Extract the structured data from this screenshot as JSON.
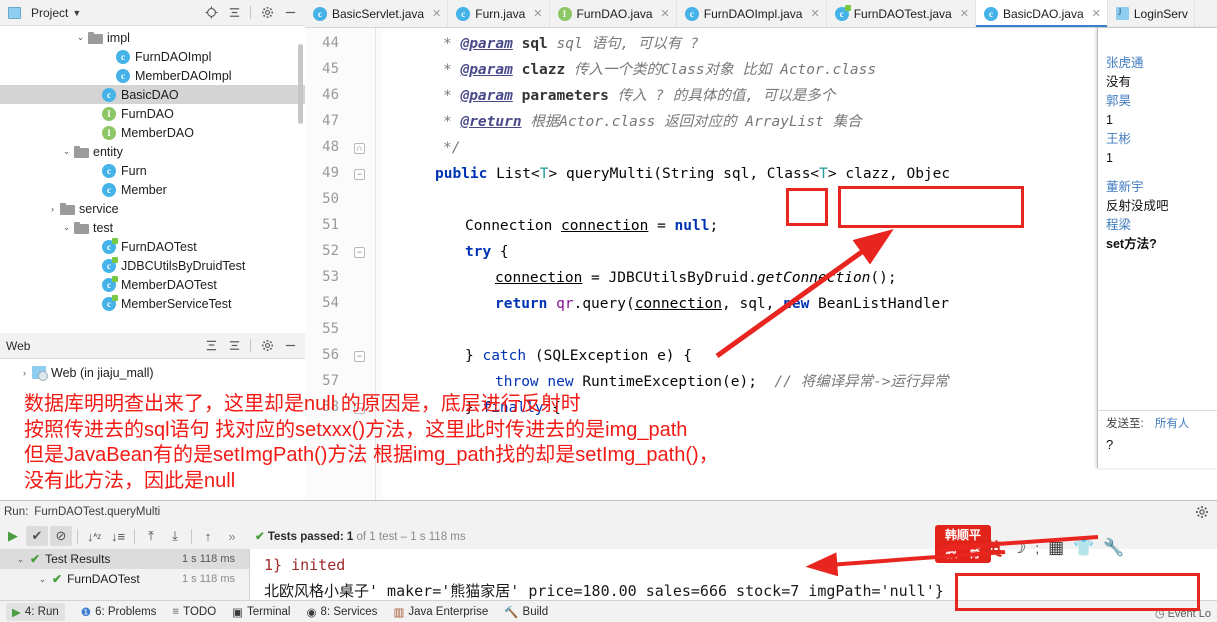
{
  "project_panel": {
    "title": "Project",
    "icons": [
      "locate-icon",
      "collapse-all-icon",
      "settings-gear-icon",
      "minimize-icon"
    ],
    "tree": [
      {
        "label": "impl",
        "type": "folder",
        "twisty": "down",
        "indent": 5
      },
      {
        "label": "FurnDAOImpl",
        "type": "class",
        "twisty": "",
        "indent": 7
      },
      {
        "label": "MemberDAOImpl",
        "type": "class",
        "twisty": "",
        "indent": 7
      },
      {
        "label": "BasicDAO",
        "type": "class",
        "twisty": "",
        "indent": 6,
        "selected": true
      },
      {
        "label": "FurnDAO",
        "type": "interface",
        "twisty": "",
        "indent": 6
      },
      {
        "label": "MemberDAO",
        "type": "interface",
        "twisty": "",
        "indent": 6
      },
      {
        "label": "entity",
        "type": "folder",
        "twisty": "down",
        "indent": 4
      },
      {
        "label": "Furn",
        "type": "class",
        "twisty": "",
        "indent": 6
      },
      {
        "label": "Member",
        "type": "class",
        "twisty": "",
        "indent": 6
      },
      {
        "label": "service",
        "type": "folder",
        "twisty": "right",
        "indent": 3
      },
      {
        "label": "test",
        "type": "folder",
        "twisty": "down",
        "indent": 4
      },
      {
        "label": "FurnDAOTest",
        "type": "testclass",
        "twisty": "",
        "indent": 6
      },
      {
        "label": "JDBCUtilsByDruidTest",
        "type": "testclass",
        "twisty": "",
        "indent": 6
      },
      {
        "label": "MemberDAOTest",
        "type": "testclass",
        "twisty": "",
        "indent": 6
      },
      {
        "label": "MemberServiceTest",
        "type": "testclass",
        "twisty": "",
        "indent": 6
      }
    ]
  },
  "web_panel": {
    "title": "Web",
    "icons": [
      "expand-all-icon",
      "collapse-all-icon",
      "settings-gear-icon",
      "minimize-icon"
    ],
    "tree": [
      {
        "label": "Web (in jiaju_mall)",
        "type": "web",
        "twisty": "right",
        "indent": 1
      }
    ]
  },
  "editor_tabs": [
    {
      "label": "BasicServlet.java",
      "icon": "class-icon",
      "active": false,
      "closable": true
    },
    {
      "label": "Furn.java",
      "icon": "class-icon",
      "active": false,
      "closable": true
    },
    {
      "label": "FurnDAO.java",
      "icon": "interface-icon",
      "active": false,
      "closable": true
    },
    {
      "label": "FurnDAOImpl.java",
      "icon": "class-icon",
      "active": false,
      "closable": true
    },
    {
      "label": "FurnDAOTest.java",
      "icon": "testclass-icon",
      "active": false,
      "closable": true
    },
    {
      "label": "BasicDAO.java",
      "icon": "class-icon",
      "active": true,
      "closable": true
    },
    {
      "label": "LoginServ",
      "icon": "servlet-icon",
      "active": false,
      "closable": false
    }
  ],
  "code": {
    "line_numbers": [
      "44",
      "45",
      "46",
      "47",
      "48",
      "49",
      "50",
      "51",
      "52",
      "53",
      "54",
      "55",
      "56",
      "57",
      "58"
    ],
    "lines": [
      {
        "n": "44",
        "text": "* @param sql sql 语句, 可以有 ?"
      },
      {
        "n": "45",
        "text": "* @param clazz 传入一个类的Class对象 比如 Actor.class"
      },
      {
        "n": "46",
        "text": "* @param parameters 传入 ? 的具体的值, 可以是多个"
      },
      {
        "n": "47",
        "text": "* @return 根据Actor.class 返回对应的 ArrayList 集合"
      },
      {
        "n": "48",
        "text": "*/"
      },
      {
        "n": "49",
        "text": "public List<T> queryMulti(String sql, Class<T> clazz, Object..."
      },
      {
        "n": "50",
        "text": ""
      },
      {
        "n": "51",
        "text": "Connection connection = null;"
      },
      {
        "n": "52",
        "text": "try {"
      },
      {
        "n": "53",
        "text": "connection = JDBCUtilsByDruid.getConnection();"
      },
      {
        "n": "54",
        "text": "return qr.query(connection, sql, new BeanListHandler"
      },
      {
        "n": "55",
        "text": ""
      },
      {
        "n": "56",
        "text": "} catch (SQLException e) {"
      },
      {
        "n": "57",
        "text": "throw new RuntimeException(e);   // 将编译异常->运行异常"
      },
      {
        "n": "58",
        "text": "} finally {"
      }
    ]
  },
  "annotation": {
    "color": "#f21a15",
    "lines": [
      "数据库明明查出来了，这里却是null 的原因是，底层进行反射时",
      "按照传进去的sql语句 找对应的setxxx()方法，这里此时传进去的是img_path",
      "但是JavaBean有的是setImgPath()方法 根据img_path找的却是setImg_path()，",
      "没有此方法，因此是null"
    ]
  },
  "chat": {
    "messages": [
      {
        "name": "张虎通",
        "text": "没有"
      },
      {
        "name": "郭昊",
        "text": "1"
      },
      {
        "name": "王彬",
        "text": "1"
      },
      {
        "name": "董新宇",
        "text": "反射没成吧"
      },
      {
        "name": "程梁",
        "text": "set方法?"
      }
    ],
    "send_to_label": "发送至:",
    "send_to_value": "所有人",
    "input_value": "?"
  },
  "run_panel": {
    "run_label": "Run:",
    "breadcrumb": "FurnDAOTest.queryMulti",
    "toolbar_icons": [
      "rerun-icon",
      "show-passed-icon",
      "hide-ignored-icon",
      "sort-alpha-icon",
      "sort-duration-icon",
      "expand-all-icon",
      "collapse-all-icon",
      "up-icon",
      "more-icon"
    ],
    "status_prefix": "Tests passed:",
    "status_count": "1",
    "status_suffix": "of 1 test – 1 s 118 ms",
    "gear_icon": "settings-gear-icon",
    "tests": [
      {
        "label": "Test Results",
        "duration": "1 s 118 ms",
        "indent": 0,
        "selected": true
      },
      {
        "label": "FurnDAOTest",
        "duration": "1 s 118 ms",
        "indent": 1,
        "selected": false
      }
    ],
    "console": [
      {
        "text": "1} inited",
        "color": "red"
      },
      {
        "text": "北欧风格小桌子'  maker='熊猫家居'  price=180.00  sales=666  stock=7  imgPath='null'}",
        "color": "black"
      }
    ]
  },
  "status_tabs": [
    {
      "label": "4: Run",
      "icon": "play-icon",
      "active": true
    },
    {
      "label": "6: Problems",
      "icon": "problems-icon",
      "active": false
    },
    {
      "label": "TODO",
      "icon": "todo-icon",
      "active": false
    },
    {
      "label": "Terminal",
      "icon": "terminal-icon",
      "active": false
    },
    {
      "label": "8: Services",
      "icon": "services-icon",
      "active": false
    },
    {
      "label": "Java Enterprise",
      "icon": "java-enterprise-icon",
      "active": false
    },
    {
      "label": "Build",
      "icon": "build-icon",
      "active": false
    }
  ],
  "event_log": "Event Lo",
  "watermark": {
    "line1": "韩顺平",
    "line2": "教 育",
    "color": "#e2231a"
  },
  "ime_bar": {
    "items": [
      "英",
      "moon-icon",
      "semicolon-icon",
      "keyboard-icon",
      "skin-icon",
      "wrench-icon"
    ]
  },
  "highlights": {
    "box_color": "#e8251f",
    "arrow_color": "#e8251f"
  }
}
